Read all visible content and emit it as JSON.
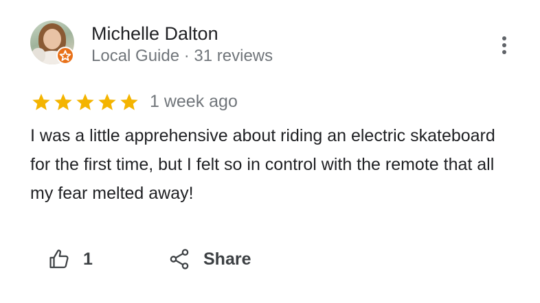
{
  "reviewer": {
    "name": "Michelle Dalton",
    "subtitle": "Local Guide · 31 reviews",
    "badge_icon": "local-guide-star-icon"
  },
  "review": {
    "rating": 5,
    "rating_max": 5,
    "date": "1 week ago",
    "text": "I was a little apprehensive about riding an electric skateboard for the first time, but I felt so in control with the remote that all my fear melted away!"
  },
  "actions": {
    "like_count": "1",
    "share_label": "Share"
  },
  "icons": {
    "menu": "more-vert-icon",
    "like": "thumbs-up-icon",
    "share": "share-icon"
  },
  "colors": {
    "star": "#f4b400",
    "badge": "#e8711a",
    "text_primary": "#202124",
    "text_secondary": "#70757a",
    "action_text": "#3c4043"
  }
}
